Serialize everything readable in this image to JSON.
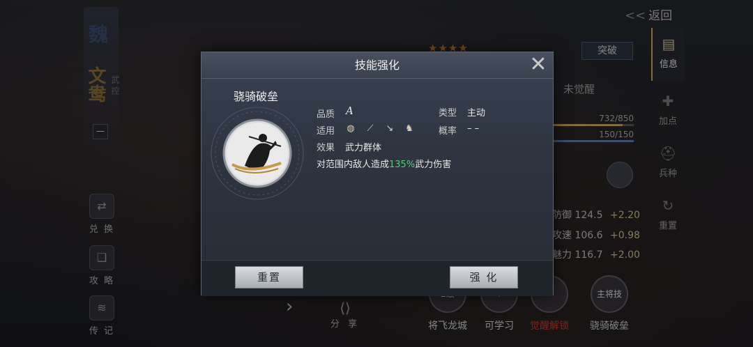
{
  "background": {
    "faction_char": "魏",
    "hero_name": "文鸯",
    "hero_sub": "武 控",
    "hero_level": "一",
    "side_buttons": [
      {
        "label": "兑 换"
      },
      {
        "label": "攻 略"
      },
      {
        "label": "传 记"
      }
    ],
    "back_label": "返回",
    "stars": "★★★★",
    "breakthrough_label": "突破",
    "awake_status": "未觉醒",
    "exp_bar": "732/850",
    "hp_bar": "150/150",
    "stats": [
      {
        "name": "防御",
        "value": "124.5",
        "bonus": "+2.20"
      },
      {
        "name": "攻速",
        "value": "106.6",
        "bonus": "+0.98"
      },
      {
        "name": "魅力",
        "value": "116.7",
        "bonus": "+2.00"
      }
    ],
    "tabs": [
      {
        "label": "信息"
      },
      {
        "label": "加点"
      },
      {
        "label": "兵种"
      },
      {
        "label": "重置"
      }
    ],
    "skill_slots": [
      {
        "circle": "2级",
        "label": "将飞龙城"
      },
      {
        "circle": "+",
        "label": "可学习"
      },
      {
        "circle": "",
        "label": "觉醒解锁"
      },
      {
        "circle": "主将技",
        "label": "骁骑破垒"
      }
    ],
    "share_label": "分 享"
  },
  "dialog": {
    "title": "技能强化",
    "skill_name": "骁骑破垒",
    "quality_label": "品质",
    "quality_value": "A",
    "type_label": "类型",
    "type_value": "主动",
    "apply_label": "适用",
    "apply_icons": [
      "shield-icon",
      "bow-icon",
      "spear-icon",
      "horse-icon"
    ],
    "chance_label": "概率",
    "chance_value": "– –",
    "effect_label": "效果",
    "effect_value": "武力群体",
    "description_prefix": "对范围内敌人造成",
    "description_pct": "135%",
    "description_suffix": "武力伤害",
    "reset_label": "重置",
    "enhance_label": "强 化"
  },
  "colors": {
    "accent_gold": "#c9a55b",
    "pct_green": "#5ec77a",
    "awake_red": "#c0392b"
  }
}
